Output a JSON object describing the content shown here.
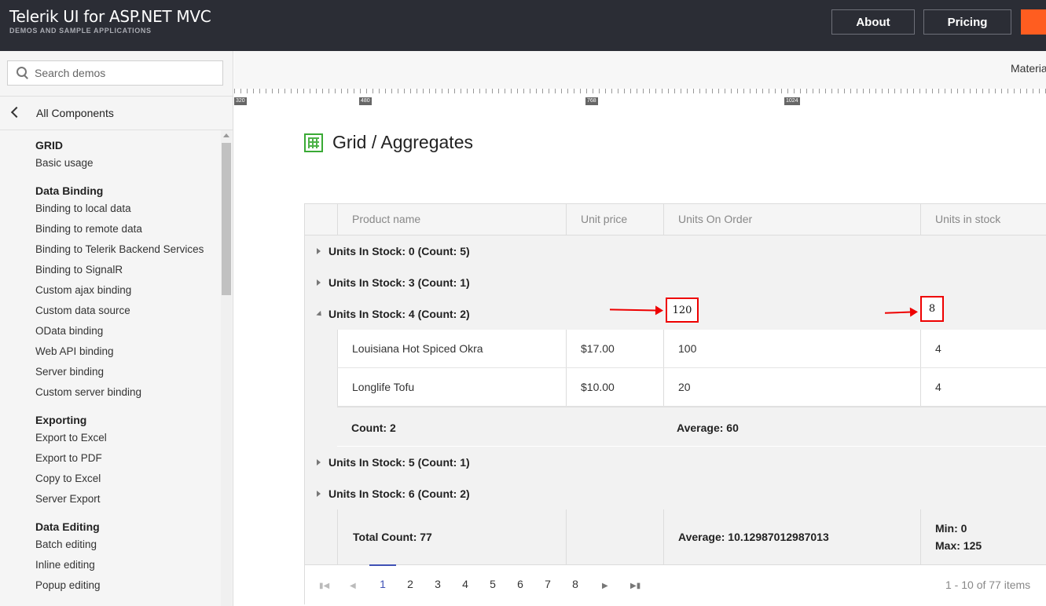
{
  "header": {
    "brand_title": "Telerik UI for ASP.NET MVC",
    "brand_subtitle": "DEMOS AND SAMPLE APPLICATIONS",
    "about_label": "About",
    "pricing_label": "Pricing"
  },
  "sidebar": {
    "search_placeholder": "Search demos",
    "back_label": "All Components",
    "groups": [
      {
        "title": "GRID",
        "items": [
          "Basic usage"
        ]
      },
      {
        "title": "Data Binding",
        "items": [
          "Binding to local data",
          "Binding to remote data",
          "Binding to Telerik Backend Services",
          "Binding to SignalR",
          "Custom ajax binding",
          "Custom data source",
          "OData binding",
          "Web API binding",
          "Server binding",
          "Custom server binding"
        ]
      },
      {
        "title": "Exporting",
        "items": [
          "Export to Excel",
          "Export to PDF",
          "Copy to Excel",
          "Server Export"
        ]
      },
      {
        "title": "Data Editing",
        "items": [
          "Batch editing",
          "Inline editing",
          "Popup editing"
        ]
      }
    ]
  },
  "toolbar": {
    "theme_label": "Materia"
  },
  "ruler": {
    "marks": [
      "320",
      "480",
      "768",
      "1024"
    ]
  },
  "page": {
    "title": "Grid / Aggregates"
  },
  "grid": {
    "columns": [
      "Product name",
      "Unit price",
      "Units On Order",
      "Units in stock"
    ],
    "groups": [
      "Units In Stock: 0 (Count: 5)",
      "Units In Stock: 3 (Count: 1)",
      "Units In Stock: 4 (Count: 2)",
      "Units In Stock: 5 (Count: 1)",
      "Units In Stock: 6 (Count: 2)"
    ],
    "rows": [
      [
        "Louisiana Hot Spiced Okra",
        "$17.00",
        "100",
        "4"
      ],
      [
        "Longlife Tofu",
        "$10.00",
        "20",
        "4"
      ]
    ],
    "group_footer": {
      "count": "Count: 2",
      "average": "Average: 60"
    },
    "total": {
      "count": "Total Count: 77",
      "average": "Average: 10.12987012987013",
      "min": "Min: 0",
      "max": "Max: 125"
    },
    "pager": {
      "pages": [
        "1",
        "2",
        "3",
        "4",
        "5",
        "6",
        "7",
        "8"
      ],
      "first_icon": "first-page-icon",
      "prev_icon": "prev-page-icon",
      "next_icon": "next-page-icon",
      "last_icon": "last-page-icon",
      "info": "1 - 10 of 77 items"
    }
  },
  "annotations": {
    "box1": "120",
    "box2": "8",
    "color": "#e00000"
  }
}
